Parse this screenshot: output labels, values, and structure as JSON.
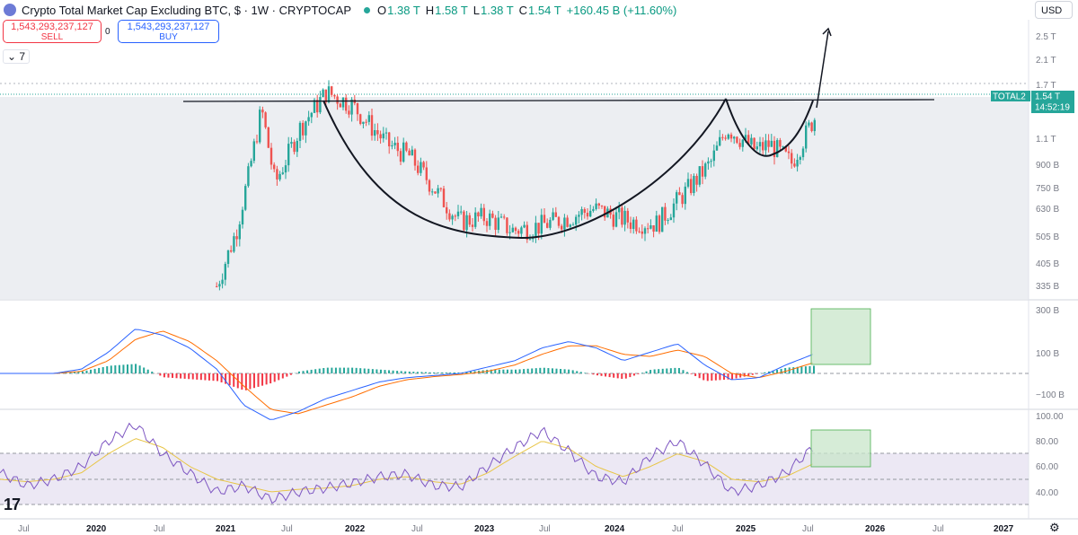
{
  "header": {
    "title": "Crypto Total Market Cap Excluding BTC, $ · 1W · CRYPTOCAP",
    "open_label": "O",
    "open": "1.38 T",
    "high_label": "H",
    "high": "1.58 T",
    "low_label": "L",
    "low": "1.38 T",
    "close_label": "C",
    "close": "1.54 T",
    "change": "+160.45 B (+11.60%)"
  },
  "trade": {
    "sell_price": "1,543,293,237,127",
    "sell_label": "SELL",
    "spread": "0",
    "buy_price": "1,543,293,237,127",
    "buy_label": "BUY"
  },
  "indicator_toggle": {
    "arrow": "⌄",
    "count": "7"
  },
  "currency": "USD",
  "price_tag": {
    "symbol": "TOTAL2",
    "price": "1.54 T",
    "countdown": "14:52:19"
  },
  "colors": {
    "up": "#26a69a",
    "down": "#ef5350",
    "accent": "#2962ff",
    "macd": "#2962ff",
    "signal": "#ff6d00",
    "rsi": "#7e57c2",
    "rsi_ma": "#e8c547"
  },
  "time_axis": [
    {
      "label": "Jul",
      "bold": false
    },
    {
      "label": "2020",
      "bold": true
    },
    {
      "label": "Jul",
      "bold": false
    },
    {
      "label": "2021",
      "bold": true
    },
    {
      "label": "Jul",
      "bold": false
    },
    {
      "label": "2022",
      "bold": true
    },
    {
      "label": "Jul",
      "bold": false
    },
    {
      "label": "2023",
      "bold": true
    },
    {
      "label": "Jul",
      "bold": false
    },
    {
      "label": "2024",
      "bold": true
    },
    {
      "label": "Jul",
      "bold": false
    },
    {
      "label": "2025",
      "bold": true
    },
    {
      "label": "Jul",
      "bold": false
    },
    {
      "label": "2026",
      "bold": true
    },
    {
      "label": "Jul",
      "bold": false
    },
    {
      "label": "2027",
      "bold": true
    }
  ],
  "chart_data": [
    {
      "type": "candlestick",
      "title": "Crypto Total Market Cap Excluding BTC, $ · 1W · CRYPTOCAP",
      "y_scale": "log",
      "y_ticks": [
        "2.5 T",
        "2.1 T",
        "1.7 T",
        "1.1 T",
        "900 B",
        "750 B",
        "630 B",
        "505 B",
        "405 B",
        "335 B"
      ],
      "resistance_level": "1.54 T",
      "series": [
        {
          "x": [
            "2020-11",
            "2021-01",
            "2021-03",
            "2021-05",
            "2021-07",
            "2021-09",
            "2021-11",
            "2022-01",
            "2022-03",
            "2022-05",
            "2022-07",
            "2022-09",
            "2022-11",
            "2023-01",
            "2023-03",
            "2023-05",
            "2023-07",
            "2023-09",
            "2023-11",
            "2024-01",
            "2024-03",
            "2024-05",
            "2024-07",
            "2024-09",
            "2024-11",
            "2024-12",
            "2025-02",
            "2025-04",
            "2025-05",
            "2025-07",
            "2025-07"
          ],
          "close": [
            330,
            520,
            800,
            1400,
            760,
            1200,
            1600,
            1450,
            1050,
            950,
            560,
            580,
            520,
            540,
            590,
            620,
            560,
            550,
            700,
            900,
            1200,
            1000,
            1050,
            900,
            1300,
            1600,
            1150,
            920,
            1000,
            1250,
            1540
          ]
        }
      ]
    },
    {
      "type": "line",
      "title": "MACD",
      "y_ticks": [
        "300 B",
        "100 B",
        "−100 B"
      ],
      "series": [
        {
          "values": [
            0,
            0,
            0,
            20,
            100,
            210,
            180,
            120,
            20,
            -150,
            -220,
            -180,
            -120,
            -80,
            -40,
            -20,
            -10,
            0,
            30,
            60,
            120,
            150,
            120,
            60,
            100,
            140,
            40,
            -30,
            -20,
            40,
            90
          ]
        },
        {
          "values": [
            0,
            0,
            0,
            10,
            60,
            160,
            200,
            150,
            60,
            -60,
            -170,
            -190,
            -150,
            -110,
            -60,
            -30,
            -15,
            -5,
            10,
            40,
            90,
            130,
            130,
            90,
            80,
            110,
            80,
            0,
            -20,
            10,
            50
          ]
        }
      ]
    },
    {
      "type": "line",
      "title": "RSI",
      "y_ticks": [
        "100.00",
        "80.00",
        "60.00",
        "40.00"
      ],
      "series": [
        {
          "values": [
            55,
            45,
            50,
            60,
            80,
            93,
            70,
            55,
            40,
            45,
            34,
            40,
            43,
            47,
            52,
            54,
            45,
            44,
            60,
            75,
            88,
            72,
            52,
            48,
            68,
            80,
            62,
            40,
            45,
            55,
            75
          ]
        },
        {
          "values": [
            50,
            48,
            50,
            55,
            70,
            82,
            75,
            60,
            50,
            45,
            40,
            42,
            43,
            45,
            50,
            52,
            48,
            46,
            55,
            68,
            80,
            74,
            60,
            52,
            60,
            70,
            64,
            50,
            48,
            52,
            62
          ]
        }
      ]
    }
  ]
}
